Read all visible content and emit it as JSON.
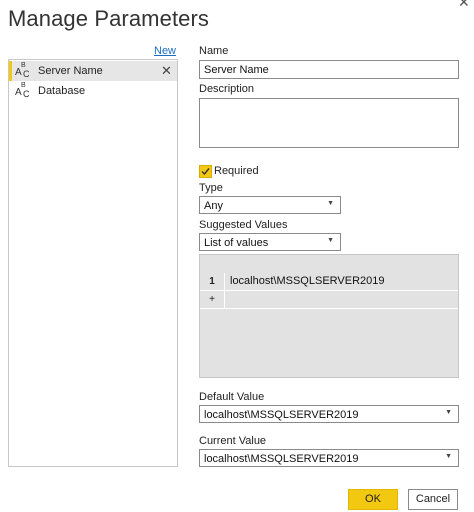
{
  "window": {
    "title": "Manage Parameters",
    "close_glyph": "✕"
  },
  "left": {
    "new_label": "New",
    "items": [
      {
        "icon": "text-type-icon",
        "a": "A",
        "b": "B",
        "c": "C",
        "label": "Server Name",
        "selected": true,
        "remove_glyph": "✕"
      },
      {
        "icon": "text-type-icon",
        "a": "A",
        "b": "B",
        "c": "C",
        "label": "Database",
        "selected": false
      }
    ]
  },
  "form": {
    "name_label": "Name",
    "name_value": "Server Name",
    "description_label": "Description",
    "description_value": "",
    "required_label": "Required",
    "required_checked": true,
    "type_label": "Type",
    "type_value": "Any",
    "suggested_label": "Suggested Values",
    "suggested_value": "List of values",
    "values_grid": {
      "rows": [
        {
          "num": "1",
          "value": "localhost\\MSSQLSERVER2019"
        }
      ],
      "add_row_glyph": "+"
    },
    "default_label": "Default Value",
    "default_value": "localhost\\MSSQLSERVER2019",
    "current_label": "Current Value",
    "current_value": "localhost\\MSSQLSERVER2019"
  },
  "buttons": {
    "ok": "OK",
    "cancel": "Cancel"
  },
  "colors": {
    "accent": "#f2c811",
    "link": "#1a6fc4",
    "grid_bg": "#e2e2e2"
  }
}
